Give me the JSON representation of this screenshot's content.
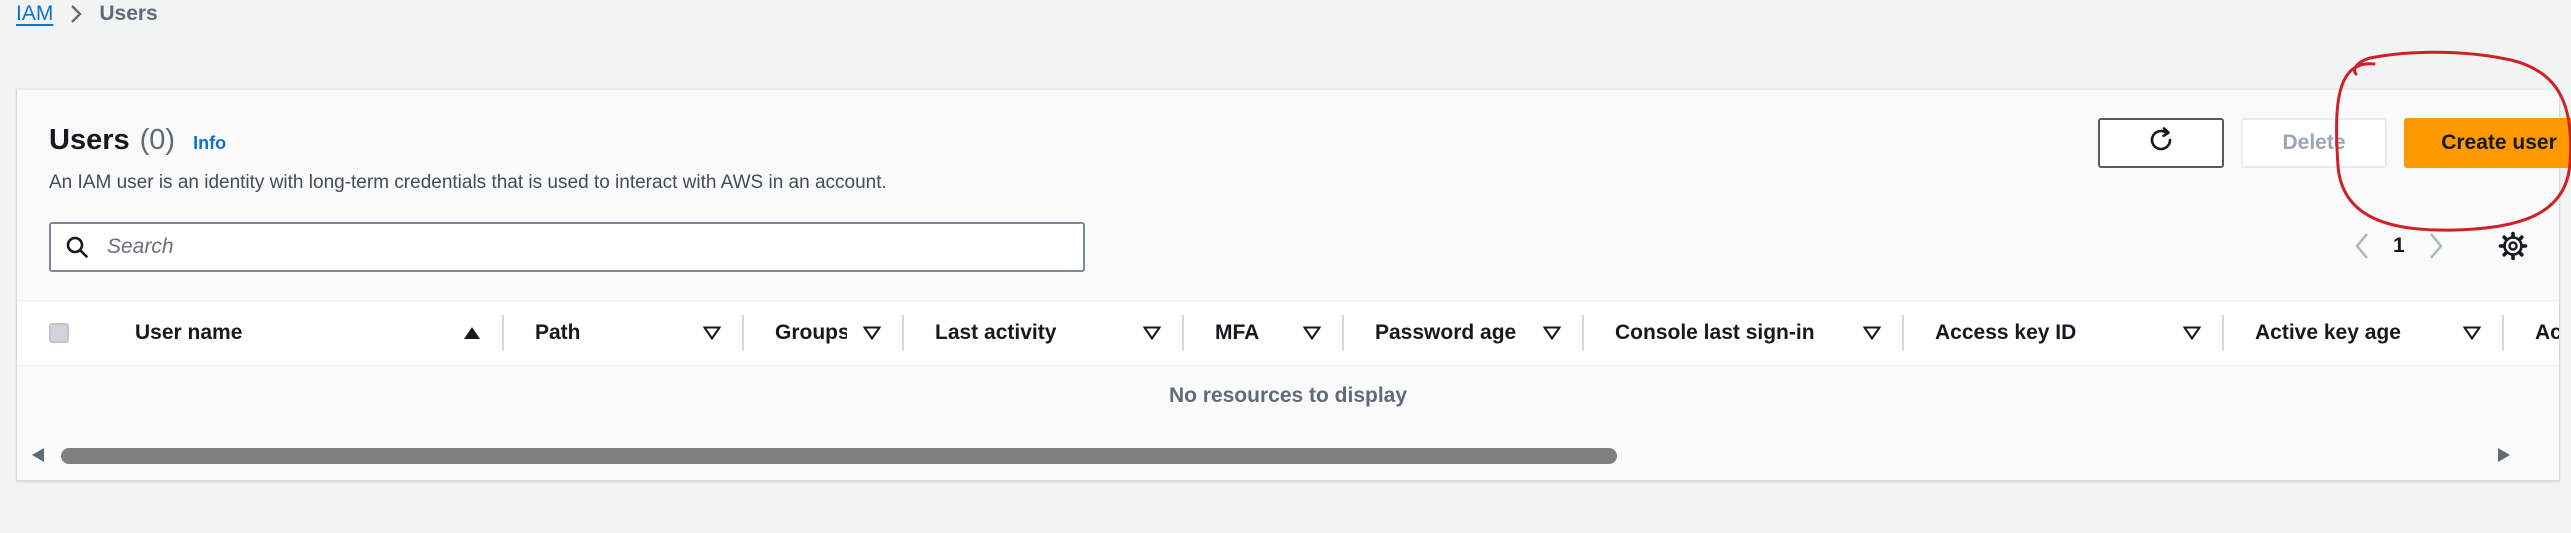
{
  "breadcrumb": {
    "root": "IAM",
    "current": "Users"
  },
  "panel": {
    "title": "Users",
    "count": "(0)",
    "info": "Info",
    "description": "An IAM user is an identity with long-term credentials that is used to interact with AWS in an account."
  },
  "actions": {
    "refresh_icon": "refresh-icon",
    "delete_label": "Delete",
    "create_label": "Create user"
  },
  "search": {
    "placeholder": "Search",
    "value": ""
  },
  "pagination": {
    "page": "1"
  },
  "table": {
    "columns": [
      {
        "label": "User name",
        "sort": "ascending"
      },
      {
        "label": "Path",
        "sort": "none"
      },
      {
        "label": "Groups",
        "sort": "none"
      },
      {
        "label": "Last activity",
        "sort": "none"
      },
      {
        "label": "MFA",
        "sort": "none"
      },
      {
        "label": "Password age",
        "sort": "none"
      },
      {
        "label": "Console last sign-in",
        "sort": "none"
      },
      {
        "label": "Access key ID",
        "sort": "none"
      },
      {
        "label": "Active key age",
        "sort": "none"
      },
      {
        "label": "Ac",
        "sort": "none"
      }
    ],
    "empty_message": "No resources to display"
  },
  "colors": {
    "accent": "#0972d3",
    "primary_button": "#ff9900",
    "annotation": "#d0202a"
  }
}
